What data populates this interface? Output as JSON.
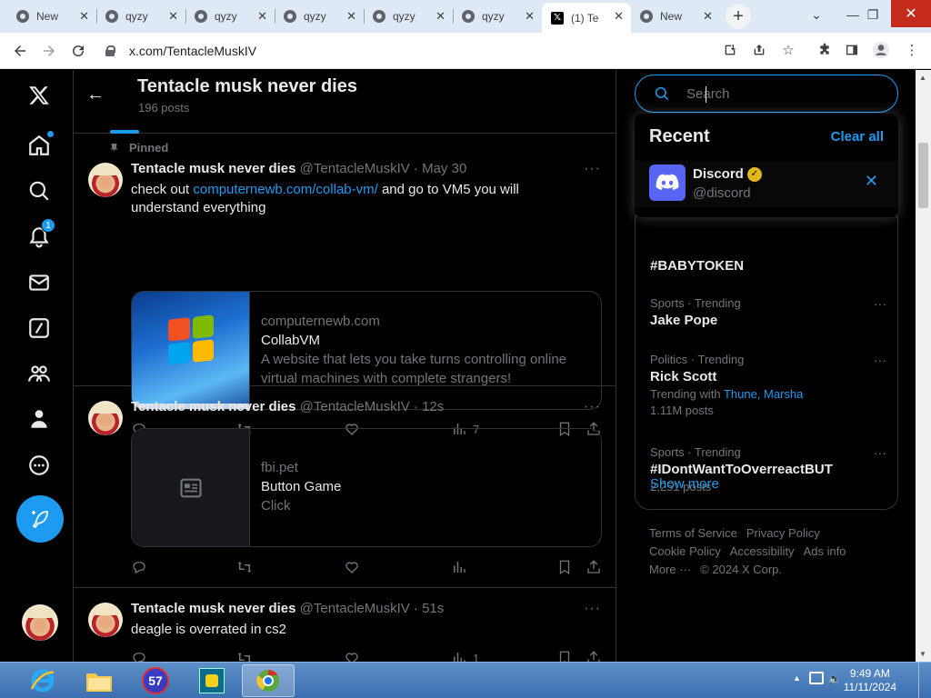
{
  "browser": {
    "tabs": [
      {
        "title": "New",
        "favicon": "chrome-icon",
        "active": false
      },
      {
        "title": "qyzy",
        "favicon": "chrome-icon",
        "active": false
      },
      {
        "title": "qyzy",
        "favicon": "chrome-icon",
        "active": false
      },
      {
        "title": "qyzy",
        "favicon": "chrome-icon",
        "active": false
      },
      {
        "title": "qyzy",
        "favicon": "chrome-icon",
        "active": false
      },
      {
        "title": "qyzy",
        "favicon": "chrome-icon",
        "active": false
      },
      {
        "title": "(1) Te",
        "favicon": "x-logo-icon",
        "active": true
      },
      {
        "title": "New",
        "favicon": "chrome-icon",
        "active": false
      }
    ],
    "url": "x.com/TentacleMuskIV"
  },
  "profile_header": {
    "title": "Tentacle musk never dies",
    "post_count": "196 posts"
  },
  "nav": {
    "notification_count": "1"
  },
  "tweets": [
    {
      "pinned_label": "Pinned",
      "name": "Tentacle musk never dies",
      "handle_time": "@TentacleMuskIV · May 30",
      "text_before": "check out ",
      "link": "computernewb.com/collab-vm/",
      "text_after": " and go to VM5 you will understand everything",
      "card": {
        "domain": "computernewb.com",
        "title": "CollabVM",
        "description": "A website that lets you take turns controlling online virtual machines with complete strangers!"
      },
      "views": "7"
    },
    {
      "name": "Tentacle musk never dies",
      "handle_time": "@TentacleMuskIV · 12s",
      "card": {
        "domain": "fbi.pet",
        "title": "Button Game",
        "description": "Click"
      }
    },
    {
      "name": "Tentacle musk never dies",
      "handle_time": "@TentacleMuskIV · 51s",
      "text": "deagle is overrated in cs2",
      "views": "1"
    }
  ],
  "search": {
    "placeholder": "Search"
  },
  "recent": {
    "title": "Recent",
    "clear_label": "Clear all",
    "items": [
      {
        "name": "Discord",
        "handle": "@discord"
      }
    ]
  },
  "trends": {
    "partial_tag": "#BABYTOKEN",
    "items": [
      {
        "category": "Sports · Trending",
        "name": "Jake Pope",
        "meta": ""
      },
      {
        "category": "Politics · Trending",
        "name": "Rick Scott",
        "meta_prefix": "Trending with ",
        "meta_link": "Thune, Marsha",
        "posts": "1.11M posts"
      },
      {
        "category": "Sports · Trending",
        "name": "#IDontWantToOverreactBUT",
        "posts": "2,251 posts"
      }
    ],
    "show_more": "Show more"
  },
  "footer": {
    "links": [
      "Terms of Service",
      "Privacy Policy",
      "Cookie Policy",
      "Accessibility",
      "Ads info",
      "More ···",
      "© 2024 X Corp."
    ]
  },
  "taskbar": {
    "time": "9:49 AM",
    "date": "11/11/2024",
    "badge": "57"
  },
  "colors": {
    "accent": "#1d9bf0",
    "background": "#000000",
    "text": "#e7e9ea",
    "muted": "#71767b",
    "border": "#2f3336"
  }
}
